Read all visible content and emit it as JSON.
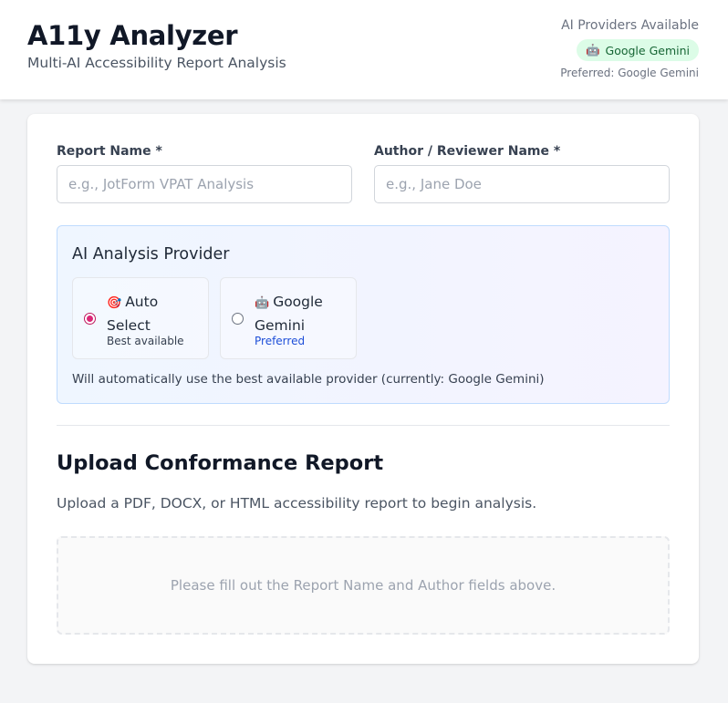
{
  "header": {
    "title": "A11y Analyzer",
    "subtitle": "Multi-AI Accessibility Report Analysis",
    "providers_title": "AI Providers Available",
    "provider_badge": "Google Gemini",
    "preferred": "Preferred: Google Gemini"
  },
  "form": {
    "report_name": {
      "label": "Report Name *",
      "value": "",
      "placeholder": "e.g., JotForm VPAT Analysis"
    },
    "author": {
      "label": "Author / Reviewer Name *",
      "value": "",
      "placeholder": "e.g., Jane Doe"
    }
  },
  "ai_provider": {
    "title": "AI Analysis Provider",
    "options": [
      {
        "name": "Auto Select",
        "sub": "Best available",
        "icon": "target-icon",
        "selected": true
      },
      {
        "name": "Google Gemini",
        "sub": "Preferred",
        "icon": "robot-icon",
        "selected": false
      }
    ],
    "note": "Will automatically use the best available provider (currently: Google Gemini)"
  },
  "upload": {
    "title": "Upload Conformance Report",
    "description": "Upload a PDF, DOCX, or HTML accessibility report to begin analysis.",
    "dropzone_text": "Please fill out the Report Name and Author fields above."
  },
  "colors": {
    "accent_pink": "#db2777",
    "badge_green_bg": "#dcfce7",
    "badge_green_text": "#166534",
    "preferred_blue": "#1d4ed8"
  }
}
